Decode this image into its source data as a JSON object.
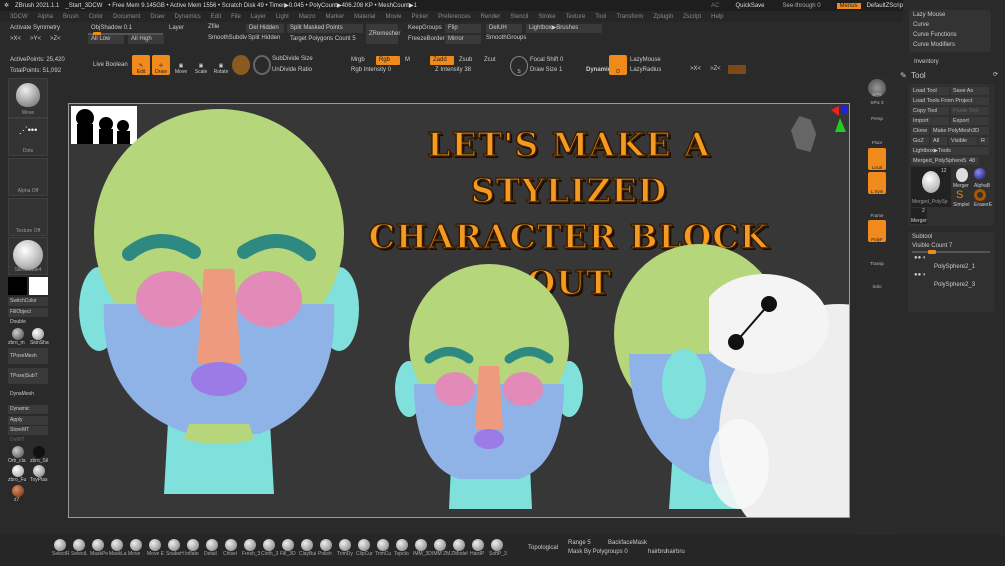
{
  "titlebar": {
    "app": "ZBrush 2021.1.1",
    "file": "_Start_3DCW",
    "stats": "• Free Mem 9.145GB • Active Mem 1556 • Scratch Disk 49 • Timer▶0.045 • PolyCount▶406.208 KP • MeshCount▶1",
    "ac": "AC",
    "quicksave": "QuickSave",
    "see_through": "See-through 0",
    "menus": "Menus",
    "script": "DefaultZScript"
  },
  "menu": [
    "3DCW",
    "Alpha",
    "Brush",
    "Color",
    "Document",
    "Draw",
    "Dynamics",
    "Edit",
    "File",
    "Layer",
    "Light",
    "Macro",
    "Marker",
    "Material",
    "Movie",
    "Picker",
    "Preferences",
    "Render",
    "Stencil",
    "Stroke",
    "Texture",
    "Tool",
    "Transform",
    "Zplugin",
    "Zscript",
    "Help"
  ],
  "toolbar1": {
    "activate_symmetry": "Activate Symmetry",
    "x": ">X<",
    "y": ">Y<",
    "z": ">Z<",
    "objshadow": "ObjShadow 0.1",
    "all_low": "All Low",
    "all_high": "All High",
    "layer": "Layer",
    "zfile": "Zfile",
    "del_hidden": "Del Hidden",
    "smooth_subdiv": "SmoothSubdiv",
    "split_hidden": "Split Hidden",
    "split_masked": "Split Masked Points",
    "target_poly": "Target Polygons Count 5",
    "zremesher": "ZRemesher",
    "keepgroups": "KeepGroups",
    "flip": "Flip",
    "freezeborder": "FreezeBorder",
    "mirror": "Mirror",
    "deluh": "DelUH",
    "smoothgroups": "SmoothGroups",
    "lightbox_brushes": "Lightbox▶Brushes"
  },
  "stats": {
    "active": "ActivePoints: 25,420",
    "total": "TotalPoints: 51,092"
  },
  "toolbar2": {
    "live_boolean": "Live Boolean",
    "edit": "Edit",
    "draw": "Draw",
    "move": "Move",
    "scale": "Scale",
    "rotate": "Rotate",
    "subdivide_size": "SubDivide Size",
    "undivide_ratio": "UnDivide Ratio",
    "mrgb": "Mrgb",
    "rgb": "Rgb",
    "m": "M",
    "rgb_intensity": "Rgb Intensity 0",
    "zadd": "Zadd",
    "zsub": "Zsub",
    "zcut": "Zcut",
    "z_intensity": "Z Intensity 38",
    "focal_shift": "Focal Shift 0",
    "draw_size": "Draw Size 1",
    "dynamic": "Dynamic",
    "lazymouse": "LazyMouse",
    "lazyradius": "LazyRadius",
    "x": ">X<",
    "z": ">Z<"
  },
  "left_shelf": {
    "brush": "Move",
    "stroke": "Dots",
    "alpha": "Alpha Off",
    "texture": "Texture Off",
    "material": "SkinShade4",
    "switchcolor": "SwitchColor",
    "fillobject": "FillObject",
    "double": "Double",
    "mat1": "zbro_m",
    "mat2": "SkinSha",
    "tposemesh": "TPoseMesh",
    "tpose_subt": "TPose|SubT",
    "dynamesh": "DynaMesh",
    "dynamic": "Dynamic",
    "apply": "Apply",
    "storemt": "StoreMT",
    "delmt": "DelMT",
    "m3": "Orb_cla",
    "m4": "zbro_Sil",
    "m5": "zbro_Fu",
    "m6": "ToyPlas",
    "m7": "z7"
  },
  "viewport": {
    "headline_line1": "LET'S MAKE A STYLIZED",
    "headline_line2": "CHARACTER BLOCK OUT"
  },
  "right_shelf": [
    "BPR",
    "SPix 3",
    "Persp",
    "Floor",
    "Local",
    "L.Sym",
    "Frame",
    "PolyF",
    "Transp",
    "Solo"
  ],
  "right_panel": {
    "lazy_mouse": "Lazy Mouse",
    "curve": "Curve",
    "curve_functions": "Curve Functions",
    "curve_modifiers": "Curve Modifiers",
    "inventory": "Inventory",
    "tool": "Tool",
    "load_tool": "Load Tool",
    "save_as": "Save As",
    "load_from_project": "Load Tools From Project",
    "copy_tool": "Copy Tool",
    "paste_tool": "Paste Tool",
    "import": "Import",
    "export": "Export",
    "clone": "Clone",
    "make_polymesh": "Make PolyMesh3D",
    "goz": "GoZ",
    "all": "All",
    "visible": "Visible",
    "r": "R",
    "lightbox_tools": "Lightbox▶Tools",
    "current_tool": "Merged_PolySphere5.",
    "current_count": "48",
    "thumb_main": "Merged_PolySp",
    "thumb_main_count": "12",
    "thumb2": "Merger",
    "thumb3": "AlphaB",
    "thumb4": "SimpleI",
    "thumb5": "EraserE",
    "thumb6": "Merger",
    "thumb6_count": "2",
    "subtool": "Subtool",
    "visible_count": "Visible Count 7",
    "subtools": [
      "PolySphere2_1",
      "PolySphere2_3"
    ]
  },
  "bottom_shelf": {
    "brushes": [
      "SelectR",
      "SelectL",
      "MaskPe",
      "MaskLa",
      "Move",
      "Move E",
      "SnakeH",
      "Inflate",
      "Detail",
      "Chisel",
      "Fresh_3",
      "Cloth_3",
      "Fill_3D",
      "ClayBui",
      "Polish",
      "TrimDy",
      "ClipCur",
      "TrimCu",
      "Topolo",
      "IMM_3D",
      "IMM ZM",
      "ZModel",
      "HardP",
      "SoftP_3"
    ],
    "topological": "Topological",
    "range": "Range 5",
    "backfacemask": "BackfaceMask",
    "mask_by_polygroups": "Mask By Polygroups 0",
    "hair1": "hairbru",
    "hair2": "hairbru"
  },
  "colors": {
    "accent": "#f08a1c",
    "skin_blue": "#8fb3e6",
    "green": "#b5d67a",
    "teal": "#2e8a80",
    "cyan": "#7fe0dc",
    "pink": "#e28ab8",
    "nose": "#ee9a7e",
    "purple": "#9b7be6"
  }
}
